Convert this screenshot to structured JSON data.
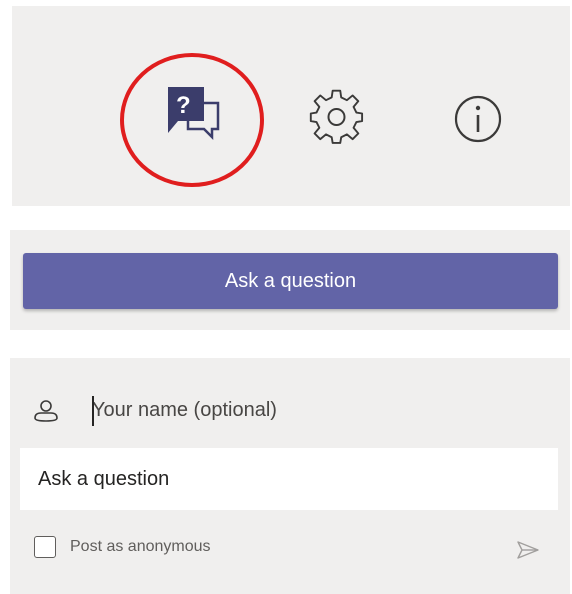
{
  "toolbar": {
    "icons": [
      "qa-icon",
      "settings-gear-icon",
      "info-icon"
    ],
    "qa_glyph": "?",
    "highlight_color": "#e01e1e",
    "accent_color": "#33345a"
  },
  "ask_section": {
    "button_label": "Ask a question",
    "button_color": "#6264a7"
  },
  "compose": {
    "name_placeholder": "Your name (optional)",
    "question_placeholder": "Ask a question",
    "anonymous_label": "Post as anonymous",
    "anonymous_checked": false
  }
}
